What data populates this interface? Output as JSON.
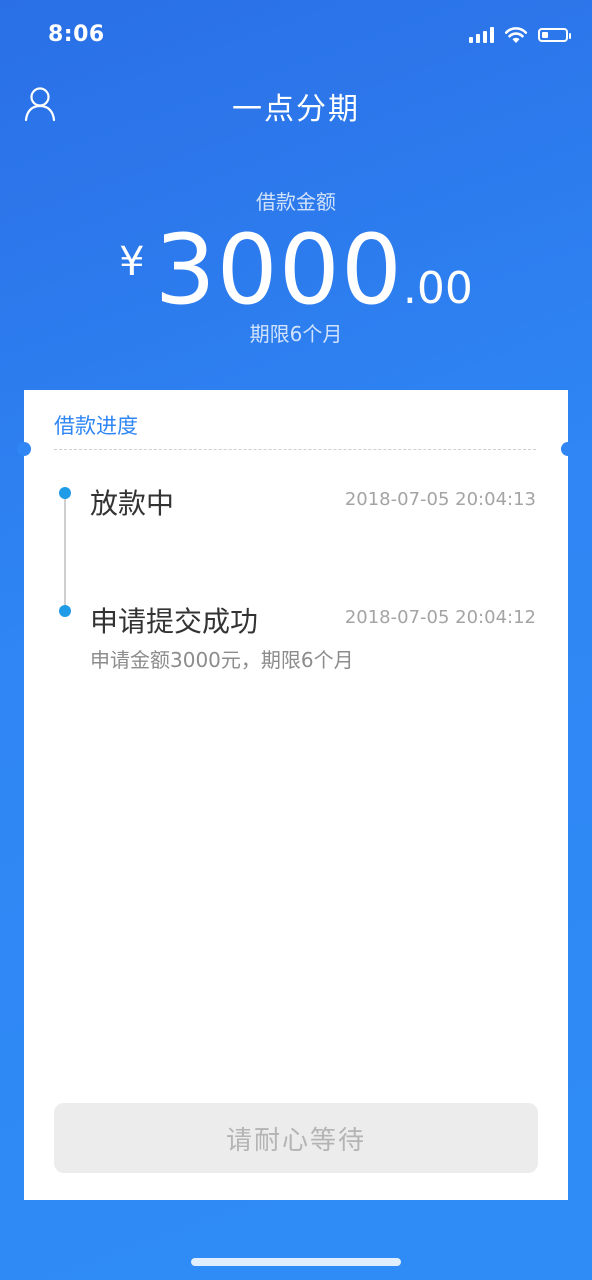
{
  "status_bar": {
    "time": "8:06",
    "icons": [
      "signal-icon",
      "wifi-icon",
      "battery-icon"
    ],
    "battery_level_fraction": 0.25
  },
  "nav": {
    "title": "一点分期",
    "left_icon": "user-icon"
  },
  "loan": {
    "amount_label": "借款金额",
    "currency_symbol": "¥",
    "amount_integer": "3000",
    "amount_decimal": ".00",
    "term_label": "期限6个月"
  },
  "progress": {
    "title": "借款进度",
    "steps": [
      {
        "title": "放款中",
        "time": "2018-07-05 20:04:13",
        "description": ""
      },
      {
        "title": "申请提交成功",
        "time": "2018-07-05 20:04:12",
        "description": "申请金额3000元，期限6个月"
      }
    ]
  },
  "action": {
    "wait_label": "请耐心等待"
  },
  "colors": {
    "brand_blue": "#2f86f4",
    "timeline_dot": "#1f9be8",
    "disabled_button_bg": "#ececec",
    "disabled_button_text": "#b4b4b4"
  }
}
